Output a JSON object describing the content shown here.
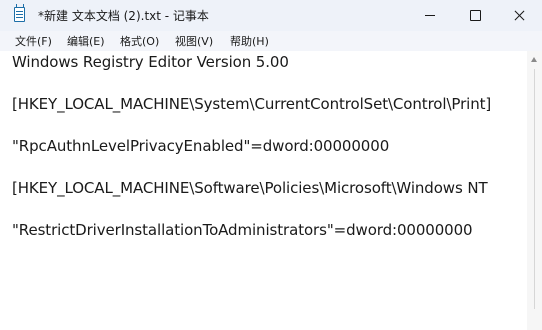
{
  "window": {
    "title": "*新建 文本文档 (2).txt - 记事本",
    "app_icon": "notepad-icon",
    "controls": [
      "minimize-icon",
      "maximize-icon",
      "close-icon"
    ]
  },
  "menu": {
    "items": [
      {
        "label": "文件(F)"
      },
      {
        "label": "编辑(E)"
      },
      {
        "label": "格式(O)"
      },
      {
        "label": "视图(V)"
      },
      {
        "label": "帮助(H)"
      }
    ]
  },
  "editor": {
    "lines": [
      "Windows Registry Editor Version 5.00",
      "[HKEY_LOCAL_MACHINE\\System\\CurrentControlSet\\Control\\Print]",
      "\"RpcAuthnLevelPrivacyEnabled\"=dword:00000000",
      "[HKEY_LOCAL_MACHINE\\Software\\Policies\\Microsoft\\Windows NT",
      "\"RestrictDriverInstallationToAdministrators\"=dword:00000000"
    ]
  },
  "scrollbar": {
    "icon": "scroll-up-arrow-icon"
  }
}
